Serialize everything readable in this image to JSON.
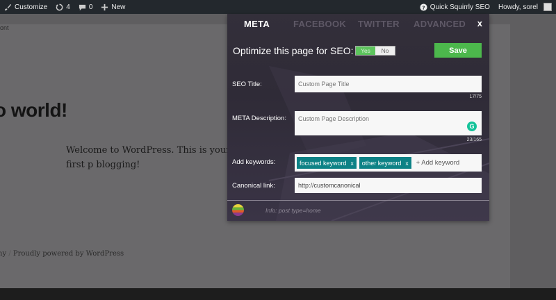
{
  "adminbar": {
    "customize_label": "Customize",
    "updates_count": "4",
    "comments_count": "0",
    "new_label": "New",
    "seo_label": "Quick Squirrly SEO",
    "howdy_label": "Howdy, sorel"
  },
  "site": {
    "crumb_text": "ont",
    "post_title": "o world!",
    "post_body": "Welcome to WordPress. This is your first p blogging!",
    "footer_left": "ny",
    "footer_sep": "/",
    "footer_right": "Proudly powered by WordPress"
  },
  "panel": {
    "tabs": [
      {
        "label": "META",
        "active": true
      },
      {
        "label": "FACEBOOK",
        "active": false
      },
      {
        "label": "TWITTER",
        "active": false
      },
      {
        "label": "ADVANCED",
        "active": false
      }
    ],
    "close_label": "x",
    "optimize_label": "Optimize this page for SEO:",
    "toggle": {
      "yes_label": "Yes",
      "no_label": "No",
      "selected": "Yes"
    },
    "save_label": "Save",
    "seo_title": {
      "label": "SEO Title:",
      "placeholder": "Custom Page Title",
      "counter": "17/75"
    },
    "meta_description": {
      "label": "META Description:",
      "placeholder": "Custom Page Description",
      "counter": "23/165"
    },
    "keywords": {
      "label": "Add keywords:",
      "items": [
        {
          "text": "focused keyword",
          "remove": "x"
        },
        {
          "text": "other keyword",
          "remove": "x"
        }
      ],
      "add_placeholder": "+ Add keyword"
    },
    "canonical": {
      "label": "Canonical link:",
      "value": "http://customcanonical"
    },
    "info_text": "Info: post type=home"
  },
  "colors": {
    "accent_green": "#4cb84c",
    "chip_teal": "#0d8286",
    "panel_bg": "#332f3a"
  }
}
